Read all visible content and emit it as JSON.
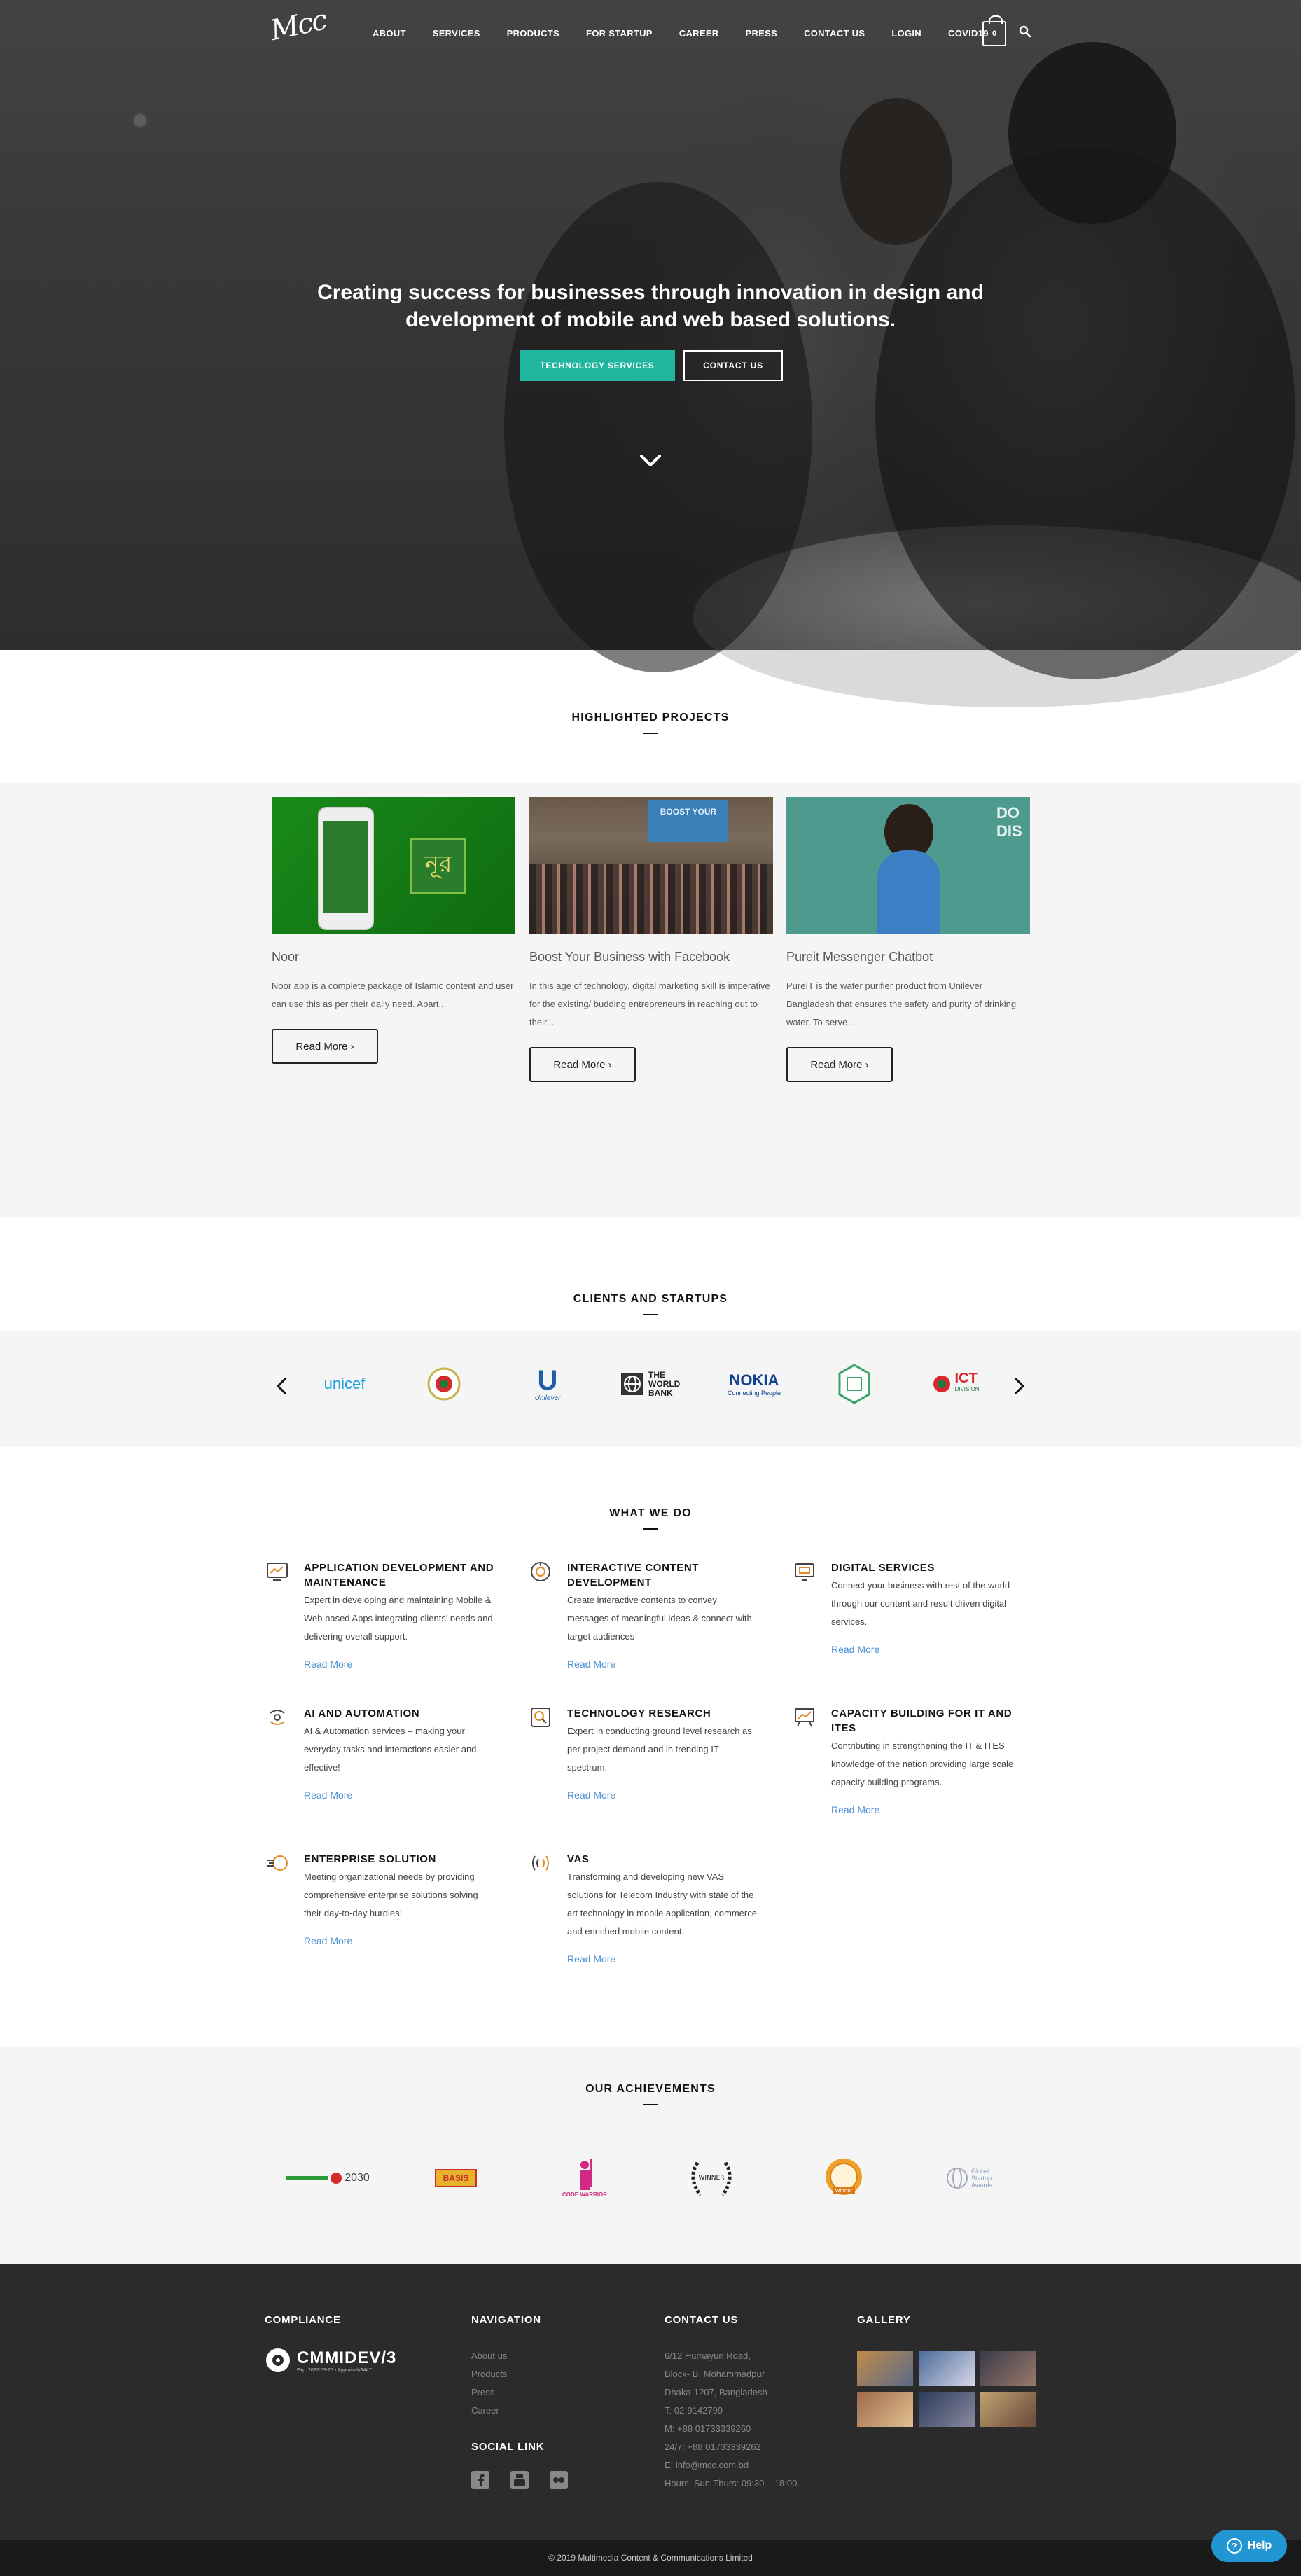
{
  "nav": {
    "logo": "Mcc",
    "items": [
      "ABOUT",
      "SERVICES",
      "PRODUCTS",
      "FOR STARTUP",
      "CAREER",
      "PRESS",
      "CONTACT US",
      "LOGIN",
      "COVID19"
    ],
    "cart_count": "0"
  },
  "hero": {
    "headline": "Creating success for businesses through innovation in design and development of mobile and web based solutions.",
    "primary_btn": "TECHNOLOGY SERVICES",
    "secondary_btn": "CONTACT US"
  },
  "projects": {
    "title": "HIGHLIGHTED PROJECTS",
    "items": [
      {
        "title": "Noor",
        "desc": "Noor app is a complete package of Islamic content and user can use this as per their daily need. Apart...",
        "btn": "Read More ›",
        "img_label": "নূর"
      },
      {
        "title": "Boost Your Business with Facebook",
        "desc": "In this age of technology, digital marketing skill is imperative for the existing/ budding entrepreneurs in reaching out to their...",
        "btn": "Read More ›",
        "img_label": "BOOST YOUR"
      },
      {
        "title": "Pureit Messenger Chatbot",
        "desc": "PureIT is the water purifier product from Unilever Bangladesh that ensures the safety and purity of drinking water. To serve...",
        "btn": "Read More ›",
        "img_label": "DO DIS"
      }
    ]
  },
  "clients": {
    "title": "CLIENTS AND STARTUPS",
    "logos": [
      "unicef",
      "Govt. of Bangladesh",
      "Unilever",
      "THE WORLD BANK",
      "NOKIA",
      "Bangladesh Bank",
      "ICT Division"
    ],
    "nokia_tag": "Connecting People",
    "ict_tag": "DIVISION"
  },
  "services": {
    "title": "WHAT WE DO",
    "link": "Read More",
    "items": [
      {
        "title": "APPLICATION DEVELOPMENT AND MAINTENANCE",
        "desc": "Expert in developing and maintaining Mobile & Web based Apps integrating clients' needs and delivering overall support."
      },
      {
        "title": "INTERACTIVE CONTENT DEVELOPMENT",
        "desc": "Create interactive contents to convey messages of meaningful ideas & connect with target audiences"
      },
      {
        "title": "DIGITAL SERVICES",
        "desc": "Connect your business with rest of the world through our content and result driven digital services."
      },
      {
        "title": "AI AND AUTOMATION",
        "desc": "AI & Automation services – making your everyday tasks and interactions easier and effective!"
      },
      {
        "title": "TECHNOLOGY RESEARCH",
        "desc": "Expert in conducting ground level research as per project demand and in trending IT spectrum."
      },
      {
        "title": "CAPACITY BUILDING FOR IT AND ITES",
        "desc": "Contributing in strengthening the IT & ITES knowledge of the nation providing large scale capacity building programs."
      },
      {
        "title": "ENTERPRISE SOLUTION",
        "desc": "Meeting organizational needs by providing comprehensive enterprise solutions solving their day-to-day hurdles!"
      },
      {
        "title": "VAS",
        "desc": "Transforming and developing new VAS solutions for Telecom Industry with state of the art technology in mobile application, commerce and enriched mobile content."
      }
    ]
  },
  "achievements": {
    "title": "OUR ACHIEVEMENTS",
    "badges": [
      "2030",
      "BASIS",
      "CODE WARRIOR",
      "WINNER",
      "Winner",
      "Global Startup Awards"
    ]
  },
  "footer": {
    "compliance": {
      "title": "COMPLIANCE",
      "badge": "CMMIDEV/3",
      "badge_note": "Exp. 2022-03-26 • Appraisal#34471"
    },
    "navigation": {
      "title": "NAVIGATION",
      "items": [
        "About us",
        "Products",
        "Press",
        "Career"
      ]
    },
    "social": {
      "title": "SOCIAL LINK"
    },
    "contact": {
      "title": "CONTACT US",
      "lines": [
        "6/12 Humayun Road,",
        "Block- B, Mohammadpur",
        "Dhaka-1207, Bangladesh",
        "T: 02-9142799",
        "M: +88 01733339260",
        "24/7: +88 01733339262",
        "E: info@mcc.com.bd",
        "Hours: Sun-Thurs: 09:30 – 18:00"
      ]
    },
    "gallery": {
      "title": "GALLERY"
    },
    "copyright": "© 2019 Multimedia Content & Communications Limited"
  },
  "help": {
    "label": "Help"
  },
  "colors": {
    "accent": "#20b59f",
    "link": "#4a8fd0",
    "footer_bg": "#2b2b2b",
    "help": "#2196d3"
  }
}
